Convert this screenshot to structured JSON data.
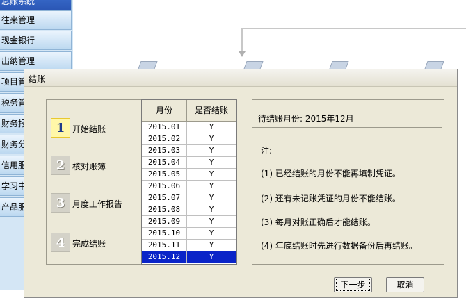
{
  "sidebar": {
    "items": [
      "总账系统",
      "往来管理",
      "现金银行",
      "出纳管理",
      "项目管",
      "税务管",
      "财务报",
      "财务分",
      "信用服",
      "学习中",
      "产品服"
    ]
  },
  "dialog": {
    "title": "结账",
    "steps": [
      {
        "number": "1",
        "label": "开始结账",
        "active": true
      },
      {
        "number": "2",
        "label": "核对账簿",
        "active": false
      },
      {
        "number": "3",
        "label": "月度工作报告",
        "active": false
      },
      {
        "number": "4",
        "label": "完成结账",
        "active": false
      }
    ],
    "table": {
      "headers": [
        "月份",
        "是否结账"
      ],
      "rows": [
        [
          "2015.01",
          "Y"
        ],
        [
          "2015.02",
          "Y"
        ],
        [
          "2015.03",
          "Y"
        ],
        [
          "2015.04",
          "Y"
        ],
        [
          "2015.05",
          "Y"
        ],
        [
          "2015.06",
          "Y"
        ],
        [
          "2015.07",
          "Y"
        ],
        [
          "2015.08",
          "Y"
        ],
        [
          "2015.09",
          "Y"
        ],
        [
          "2015.10",
          "Y"
        ],
        [
          "2015.11",
          "Y"
        ],
        [
          "2015.12",
          "Y"
        ]
      ],
      "selected_row": 11
    },
    "info": {
      "pending_month": "待结账月份: 2015年12月",
      "note_title": "注:",
      "notes": [
        "(1) 已经结账的月份不能再填制凭证。",
        "(2) 还有未记账凭证的月份不能结账。",
        "(3) 每月对账正确后才能结账。",
        "(4) 年底结账时先进行数据备份后再结账。"
      ]
    },
    "buttons": {
      "next": "下一步",
      "cancel": "取消"
    }
  }
}
